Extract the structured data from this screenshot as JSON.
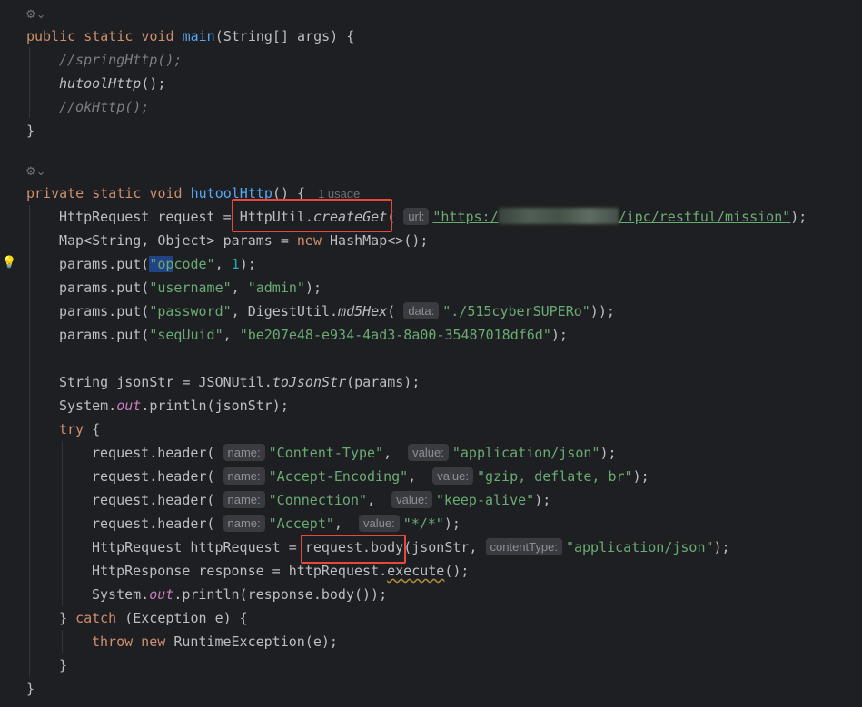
{
  "editor": {
    "gutter_icons": [
      "code-vision-icon",
      "code-vision-icon"
    ],
    "usage_hint": "1 usage",
    "hints": {
      "url": "url:",
      "data": "data:",
      "name": "name:",
      "value": "value:",
      "content_type": "contentType:"
    },
    "code": {
      "main_decl": "main",
      "main_params": "(String[] args) {",
      "c_spring": "//springHttp();",
      "hutool_call": "hutoolHttp",
      "c_ok": "//okHttp();",
      "hutool_decl": "hutoolHttp",
      "req_prefix": "HttpRequest request = ",
      "httputil": "HttpUtil.",
      "create_get": "createGet",
      "url_start": "\"https:/",
      "url_end": "/ipc/restful/mission\"",
      "map_line_a": "Map<String, Object> params = ",
      "map_line_b": "HashMap<>();",
      "put": "params.put(",
      "k_opcode_a": "\"op",
      "k_opcode_b": "code\"",
      "v_one": "1",
      "k_username": "\"username\"",
      "v_admin": "\"admin\"",
      "k_password": "\"password\"",
      "digest": "DigestUtil.",
      "md5hex": "md5Hex",
      "v_password": "\"./515cyberSUPERo\"",
      "k_sequuid": "\"seqUuid\"",
      "v_sequuid": "\"be207e48-e934-4ad3-8a00-35487018df6d\"",
      "json_line": "String jsonStr = JSONUtil.",
      "to_json": "toJsonStr",
      "json_args": "(params);",
      "sys": "System.",
      "out": "out",
      "println_json": ".println(jsonStr);",
      "header": "request.header(",
      "h1_name": "\"Content-Type\"",
      "h1_value": "\"application/json\"",
      "h2_name": "\"Accept-Encoding\"",
      "h2_value": "\"gzip, deflate, br\"",
      "h3_name": "\"Connection\"",
      "h3_value": "\"keep-alive\"",
      "h4_name": "\"Accept\"",
      "h4_value": "\"*/*\"",
      "http_req": "HttpRequest httpRequest = ",
      "req_body": "request.body",
      "body_args": "(jsonStr, ",
      "ct_value": "\"application/json\"",
      "resp_a": "HttpResponse response = httpRequest.",
      "execute": "execute",
      "println_resp": ".println(response.body());",
      "catch_params": "(Exception e) {",
      "runtime": "RuntimeException(e);"
    }
  }
}
